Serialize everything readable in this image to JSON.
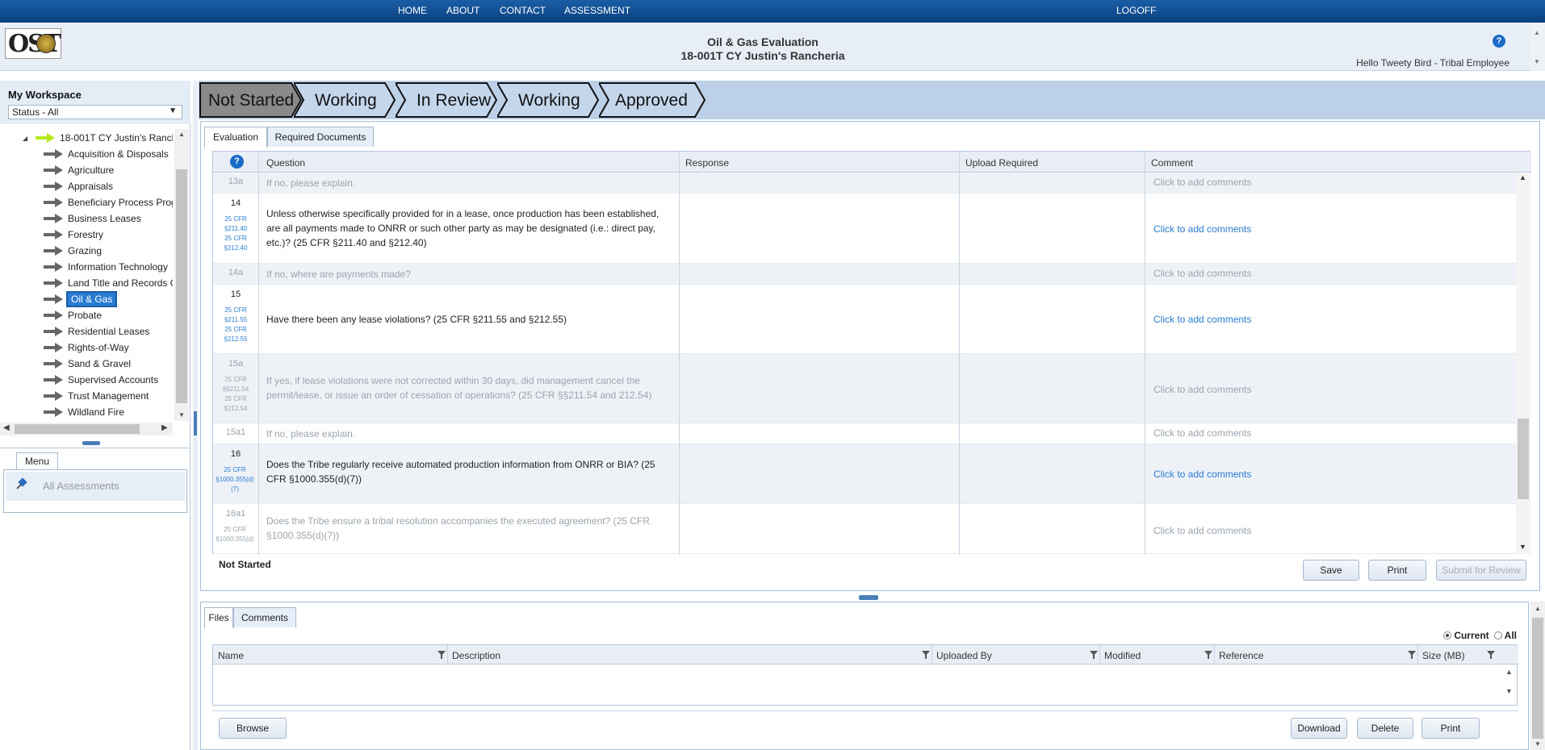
{
  "nav": {
    "home": "HOME",
    "about": "ABOUT",
    "contact": "CONTACT",
    "assessment": "ASSESSMENT",
    "logoff": "LOGOFF"
  },
  "header": {
    "logo_text": "OST",
    "title": "Oil & Gas Evaluation",
    "subtitle": "18-001T CY Justin's Rancheria",
    "help": "?",
    "greeting": "Hello Tweety Bird - Tribal Employee"
  },
  "workspace": {
    "title": "My Workspace",
    "status_filter": "Status - All",
    "tree": {
      "root": "18-001T CY Justin's Rancheria",
      "items": [
        "Acquisition & Disposals",
        "Agriculture",
        "Appraisals",
        "Beneficiary Process Program",
        "Business Leases",
        "Forestry",
        "Grazing",
        "Information Technology",
        "Land Title and Records Office",
        "Oil & Gas",
        "Probate",
        "Residential Leases",
        "Rights-of-Way",
        "Sand & Gravel",
        "Supervised Accounts",
        "Trust Management",
        "Wildland Fire"
      ],
      "selected": "Oil & Gas"
    }
  },
  "menu": {
    "tab": "Menu",
    "item": "All Assessments"
  },
  "workflow": {
    "steps": [
      "Not Started",
      "Working",
      "In Review",
      "Working",
      "Approved"
    ],
    "current": "Not Started"
  },
  "evaluation": {
    "tabs": [
      "Evaluation",
      "Required Documents"
    ],
    "columns": {
      "question": "Question",
      "response": "Response",
      "upload": "Upload Required",
      "comment": "Comment"
    },
    "rows": [
      {
        "num": "13a",
        "cfr": [],
        "question": "If no, please explain.",
        "comment": "Click to add comments",
        "sub": true
      },
      {
        "num": "14",
        "cfr": [
          "25 CFR §211.40",
          "25 CFR §212.40"
        ],
        "question": "Unless otherwise specifically provided for in a lease, once production has been established, are all payments made to ONRR or such other party as may be designated (i.e.: direct pay, etc.)? (25 CFR §211.40 and §212.40)",
        "comment": "Click to add comments",
        "sub": false
      },
      {
        "num": "14a",
        "cfr": [],
        "question": "If no, where are payments made?",
        "comment": "Click to add comments",
        "sub": true
      },
      {
        "num": "15",
        "cfr": [
          "25 CFR §211.55",
          "25 CFR §212.55"
        ],
        "question": "Have there been any lease violations? (25 CFR §211.55 and §212.55)",
        "comment": "Click to add comments",
        "sub": false
      },
      {
        "num": "15a",
        "cfr": [
          "25 CFR §§211.54",
          "25 CFR §212.54"
        ],
        "question": "If yes, if lease violations were not corrected within 30 days, did management cancel the permit/lease, or issue an order of cessation of operations? (25 CFR §§211.54 and 212.54)",
        "comment": "Click to add comments",
        "sub": true
      },
      {
        "num": "15a1",
        "cfr": [],
        "question": "If no, please explain.",
        "comment": "Click to add comments",
        "sub": true
      },
      {
        "num": "16",
        "cfr": [
          "25 CFR §1000.355(d)(7)"
        ],
        "question": "Does the Tribe regularly receive automated production information from ONRR or BIA? (25 CFR §1000.355(d)(7))",
        "comment": "Click to add comments",
        "sub": false
      },
      {
        "num": "16a1",
        "cfr": [
          "25 CFR §1000.355(d)"
        ],
        "question": "Does the Tribe ensure a tribal resolution accompanies the executed agreement? (25 CFR §1000.355(d)(7))",
        "comment": "Click to add comments",
        "sub": true
      }
    ],
    "status": "Not Started",
    "buttons": {
      "save": "Save",
      "print": "Print",
      "submit": "Submit for Review"
    }
  },
  "files": {
    "tabs": [
      "Files",
      "Comments"
    ],
    "radio_current": "Current",
    "radio_all": "All",
    "columns": [
      "Name",
      "Description",
      "Uploaded By",
      "Modified",
      "Reference",
      "Size (MB)"
    ],
    "buttons": {
      "browse": "Browse",
      "download": "Download",
      "delete": "Delete",
      "print": "Print"
    }
  },
  "colors": {
    "nav": "#0b4080",
    "workflow_current": "#8a8a8a",
    "workflow_bg": "#bcd0e8",
    "link": "#2a7bd1"
  }
}
